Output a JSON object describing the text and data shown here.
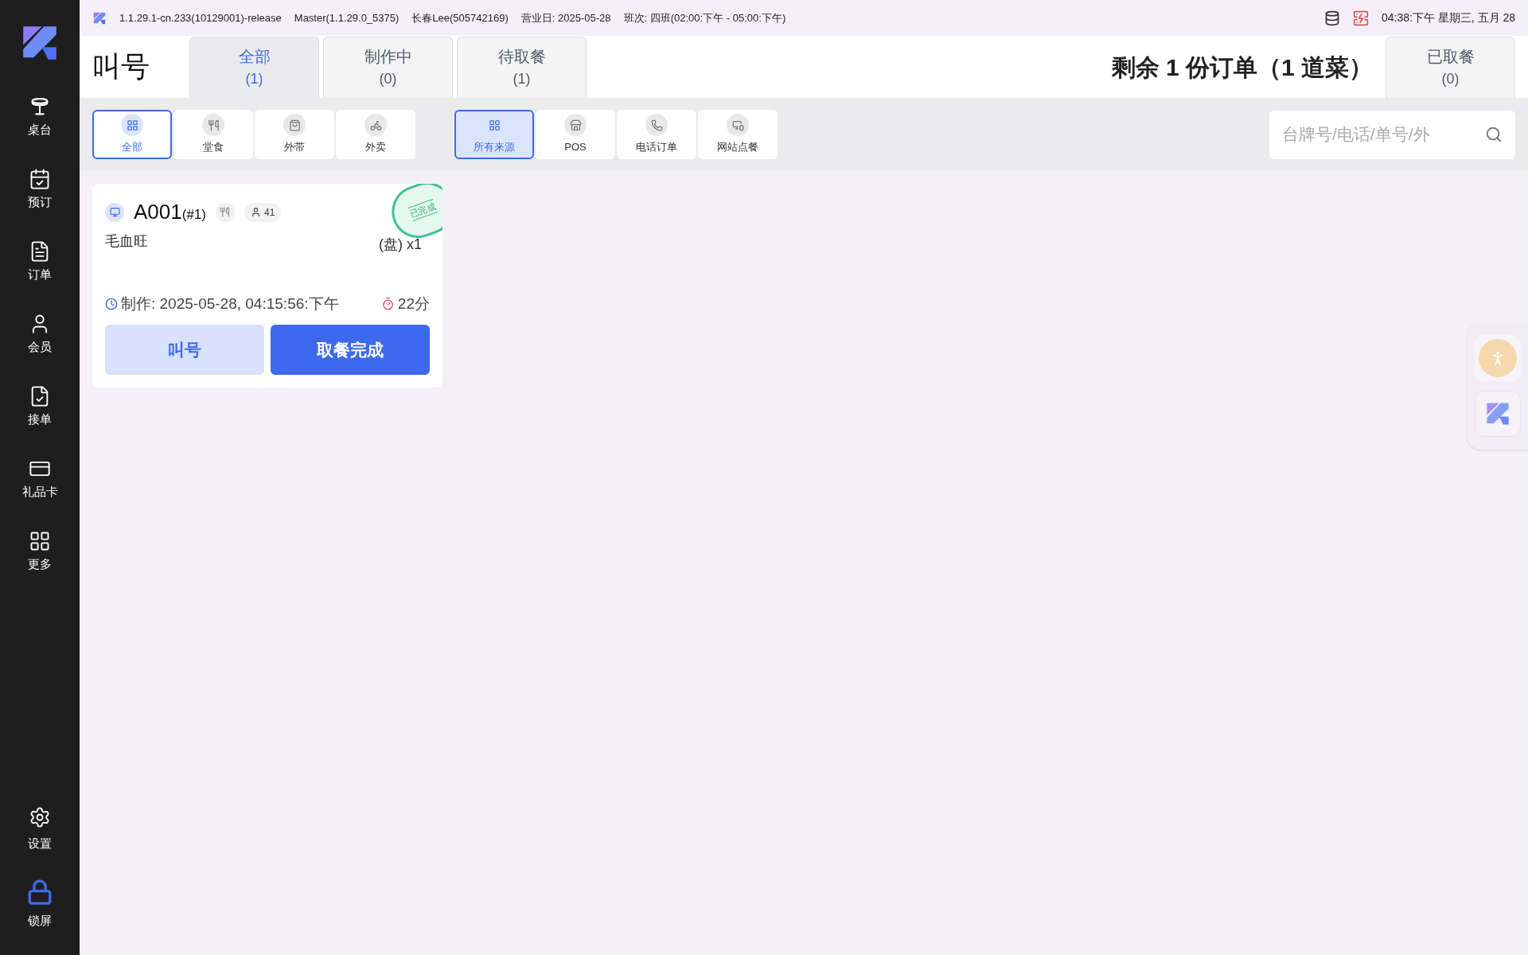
{
  "top_bar": {
    "version": "1.1.29.1-cn.233(10129001)-release",
    "master": "Master(1.1.29.0_5375)",
    "user": "长春Lee(505742169)",
    "business_day": "营业日: 2025-05-28",
    "shift": "班次: 四班(02:00:下午 - 05:00:下午)",
    "datetime": "04:38:下午 星期三, 五月 28"
  },
  "sidebar": {
    "items": [
      {
        "label": "桌台"
      },
      {
        "label": "预订"
      },
      {
        "label": "订单"
      },
      {
        "label": "会员"
      },
      {
        "label": "接单"
      },
      {
        "label": "礼品卡"
      },
      {
        "label": "更多"
      }
    ],
    "bottom_items": [
      {
        "label": "设置"
      },
      {
        "label": "锁屏"
      }
    ]
  },
  "header": {
    "title": "叫号",
    "tabs": [
      {
        "label": "全部",
        "count": "(1)",
        "selected": true
      },
      {
        "label": "制作中",
        "count": "(0)",
        "selected": false
      },
      {
        "label": "待取餐",
        "count": "(1)",
        "selected": false
      }
    ],
    "summary": "剩余 1 份订单（1 道菜）",
    "picked_tab": {
      "label": "已取餐",
      "count": "(0)",
      "selected": false
    }
  },
  "filters": {
    "order_types": [
      {
        "label": "全部",
        "selected": true
      },
      {
        "label": "堂食",
        "selected": false
      },
      {
        "label": "外带",
        "selected": false
      },
      {
        "label": "外卖",
        "selected": false
      }
    ],
    "sources": [
      {
        "label": "所有来源",
        "selected": true
      },
      {
        "label": "POS",
        "selected": false
      },
      {
        "label": "电话订单",
        "selected": false
      },
      {
        "label": "网站点餐",
        "selected": false
      }
    ],
    "search": {
      "placeholder": "台牌号/电话/单号/外"
    }
  },
  "orders": [
    {
      "number": "A001",
      "seq": "(#1)",
      "guests": "41",
      "stamp": "已完成",
      "items": [
        {
          "name": "毛血旺",
          "qty": "(盘) x1"
        }
      ],
      "made": "制作: 2025-05-28, 04:15:56:下午",
      "elapsed": "22分",
      "call_button": "叫号",
      "done_button": "取餐完成"
    }
  ]
}
